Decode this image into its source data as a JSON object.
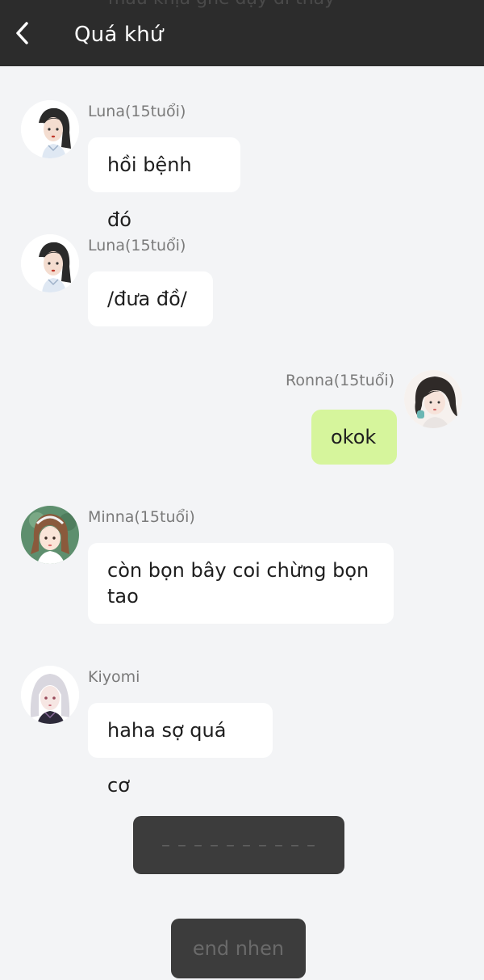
{
  "header": {
    "back_icon": "chevron-left-icon",
    "title": "Quá khứ",
    "bleed_text": "mầu khịa ghê dậy đi thây"
  },
  "messages": [
    {
      "sender": "Luna(15tuổi)",
      "text": "hồi bệnh đó",
      "side": "left",
      "avatar": "girl-dark-hair-avatar"
    },
    {
      "sender": "Luna(15tuổi)",
      "text": "/đưa đồ/",
      "side": "left",
      "avatar": "girl-dark-hair-avatar"
    },
    {
      "sender": "Ronna(15tuổi)",
      "text": "okok",
      "side": "right",
      "avatar": "girl-messy-hair-avatar"
    },
    {
      "sender": "Minna(15tuổi)",
      "text": "còn bọn bây coi chừng bọn tao",
      "side": "left",
      "avatar": "girl-brown-hair-avatar"
    },
    {
      "sender": "Kiyomi",
      "text": "haha sợ quá cơ",
      "side": "left",
      "avatar": "girl-silver-hair-avatar"
    }
  ],
  "actions": {
    "placeholder_label": "– – – – – – – – – –",
    "end_label": "end nhen"
  },
  "colors": {
    "background": "#f3f4f6",
    "topbar": "#2c2c2c",
    "own_bubble": "#d6f59c",
    "other_bubble": "#ffffff",
    "action_button": "#3c3c3c"
  }
}
